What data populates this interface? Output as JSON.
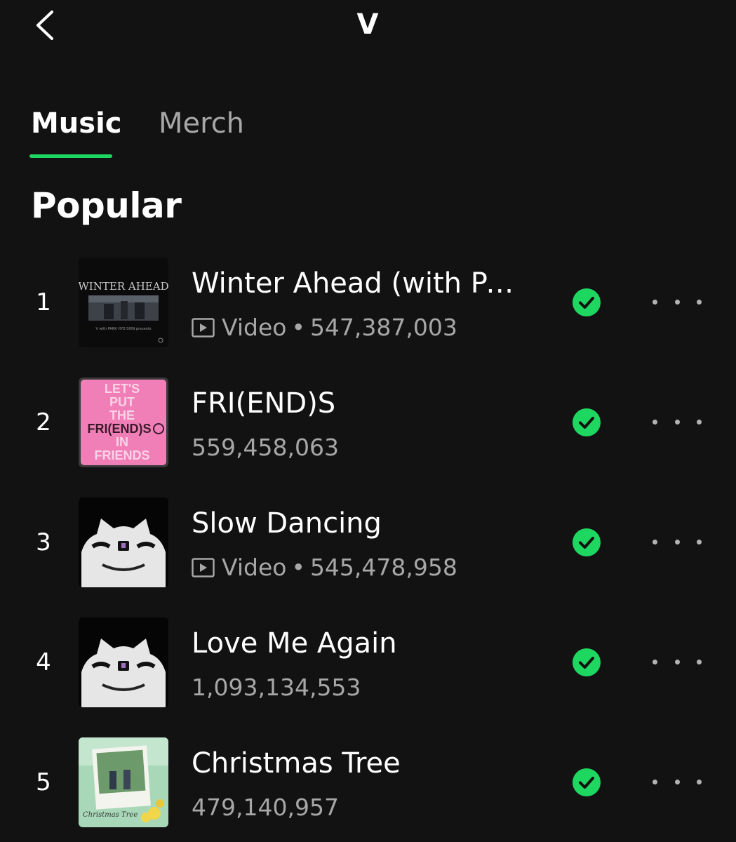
{
  "header": {
    "title": "V"
  },
  "tabs": [
    {
      "label": "Music",
      "active": true
    },
    {
      "label": "Merch",
      "active": false
    }
  ],
  "section": {
    "title": "Popular"
  },
  "tracks": [
    {
      "rank": "1",
      "title": "Winter Ahead (with PARK HYO SHIN)",
      "is_video": true,
      "type_label": "Video",
      "separator": "•",
      "plays": "547,387,003",
      "saved": true
    },
    {
      "rank": "2",
      "title": "FRI(END)S",
      "is_video": false,
      "type_label": "",
      "separator": "",
      "plays": "559,458,063",
      "saved": true
    },
    {
      "rank": "3",
      "title": "Slow Dancing",
      "is_video": true,
      "type_label": "Video",
      "separator": "•",
      "plays": "545,478,958",
      "saved": true
    },
    {
      "rank": "4",
      "title": "Love Me Again",
      "is_video": false,
      "type_label": "",
      "separator": "",
      "plays": "1,093,134,553",
      "saved": true
    },
    {
      "rank": "5",
      "title": "Christmas Tree",
      "is_video": false,
      "type_label": "",
      "separator": "",
      "plays": "479,140,957",
      "saved": true
    }
  ],
  "cover_art": {
    "cover1": {
      "line1": "WINTER AHEAD",
      "line2": "V with PARK HYO SHIN presents"
    },
    "cover2": {
      "line1": "LET'S",
      "line2": "PUT",
      "line3": "THE",
      "line4": "FRI(END)S",
      "line5": "IN",
      "line6": "FRIENDS"
    },
    "cover5": {
      "line1": "Christmas Tree"
    }
  },
  "colors": {
    "background": "#121212",
    "accent": "#1ed760",
    "secondary_text": "#a7a7a7"
  }
}
